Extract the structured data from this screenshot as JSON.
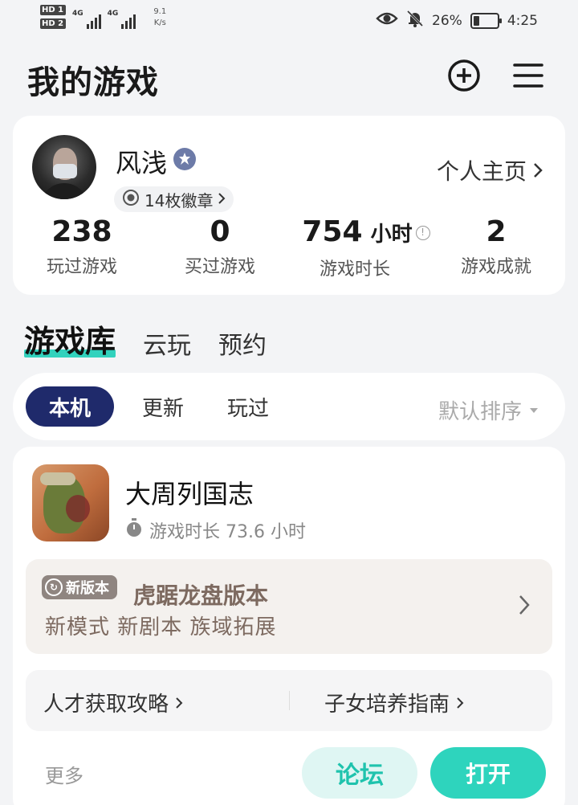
{
  "status_bar": {
    "hd1": "HD 1",
    "hd2": "HD 2",
    "sim1": "4G",
    "sim2": "4G",
    "speed_value": "9.1",
    "speed_unit": "K/s",
    "battery_percent": "26%",
    "battery_level": 0.26,
    "time": "4:25"
  },
  "header": {
    "title": "我的游戏",
    "add_icon": "plus-circle-icon",
    "menu_icon": "hamburger-menu-icon"
  },
  "profile": {
    "username": "风浅",
    "badges_label": "14枚徽章",
    "homepage_label": "个人主页",
    "stats": [
      {
        "value": "238",
        "unit": "",
        "label": "玩过游戏"
      },
      {
        "value": "0",
        "unit": "",
        "label": "买过游戏"
      },
      {
        "value": "754",
        "unit": "小时",
        "label": "游戏时长"
      },
      {
        "value": "2",
        "unit": "",
        "label": "游戏成就"
      }
    ]
  },
  "tabs": {
    "items": [
      "游戏库",
      "云玩",
      "预约"
    ],
    "active": "游戏库"
  },
  "filters": {
    "chips": [
      "本机",
      "更新",
      "玩过"
    ],
    "active": "本机",
    "sort_label": "默认排序"
  },
  "game": {
    "name": "大周列国志",
    "play_time": "游戏时长 73.6 小时",
    "promo": {
      "tag": "新版本",
      "title": "虎踞龙盘版本",
      "subtitle": "新模式 新剧本 族域拓展"
    },
    "guides": [
      "人才获取攻略",
      "子女培养指南"
    ],
    "more_label": "更多",
    "forum_label": "论坛",
    "open_label": "打开"
  },
  "colors": {
    "accent": "#2ed4bd",
    "active_chip": "#1f2a6b",
    "background": "#f3f4f6"
  }
}
